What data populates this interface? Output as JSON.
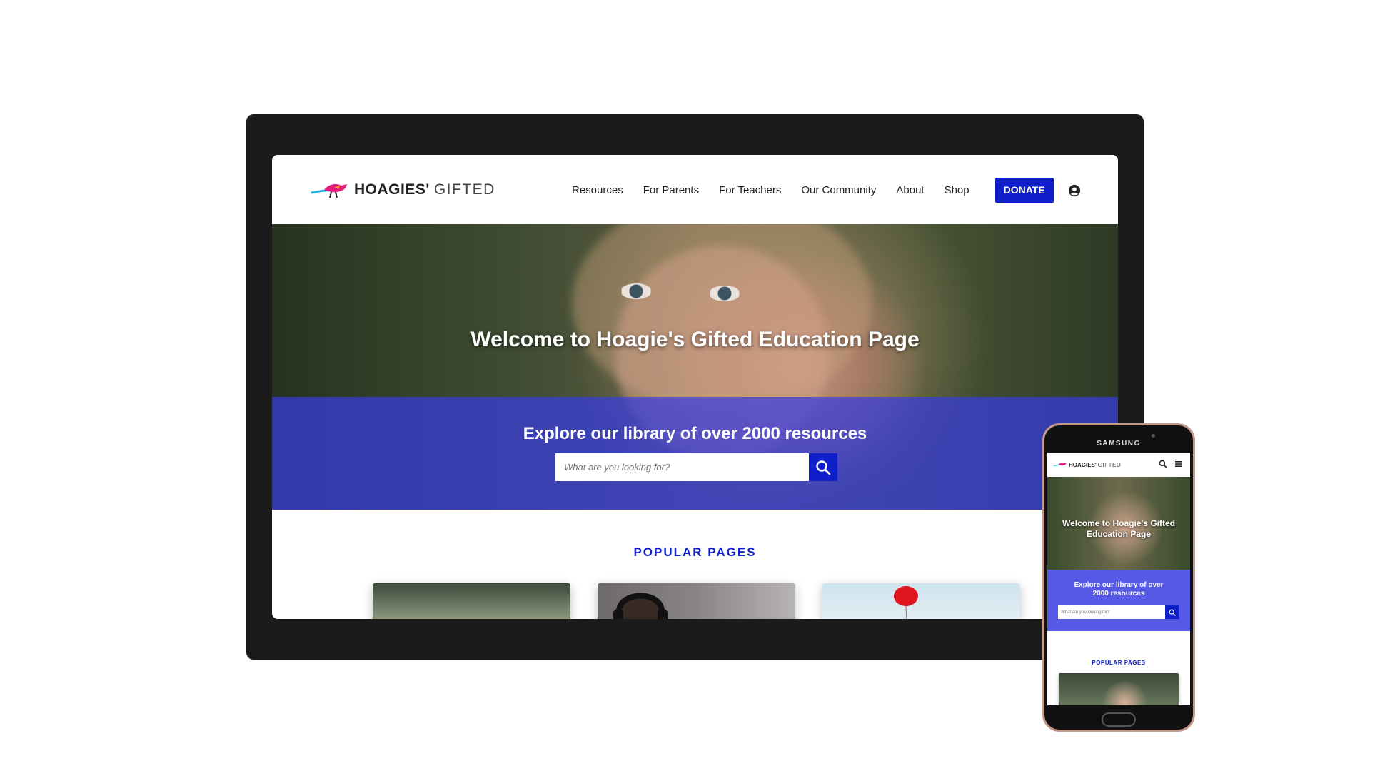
{
  "desktop": {
    "logo": {
      "brand_bold": "HOAGIES'",
      "brand_light": "GIFTED"
    },
    "nav": {
      "items": [
        "Resources",
        "For Parents",
        "For Teachers",
        "Our Community",
        "About",
        "Shop"
      ],
      "donate_label": "DONATE",
      "user_icon": "user-circle-icon"
    },
    "hero": {
      "title": "Welcome to Hoagie's Gifted Education Page"
    },
    "band": {
      "title": "Explore our library of over 2000 resources",
      "search_placeholder": "What are you looking for?",
      "search_icon": "search-icon"
    },
    "popular": {
      "heading": "POPULAR PAGES"
    }
  },
  "phone": {
    "brand_label": "SAMSUNG",
    "logo": {
      "brand_bold": "HOAGIES'",
      "brand_light": "GIFTED"
    },
    "hero_title": "Welcome to Hoagie's Gifted Education Page",
    "band_title": "Explore our library of over 2000 resources",
    "search_placeholder": "What are you looking for?",
    "popular_heading": "POPULAR PAGES",
    "icons": [
      "search-icon",
      "menu-icon"
    ]
  },
  "colors": {
    "accent": "#0f1fc9",
    "band": "#373ce1",
    "frame": "#1b1b1b"
  }
}
